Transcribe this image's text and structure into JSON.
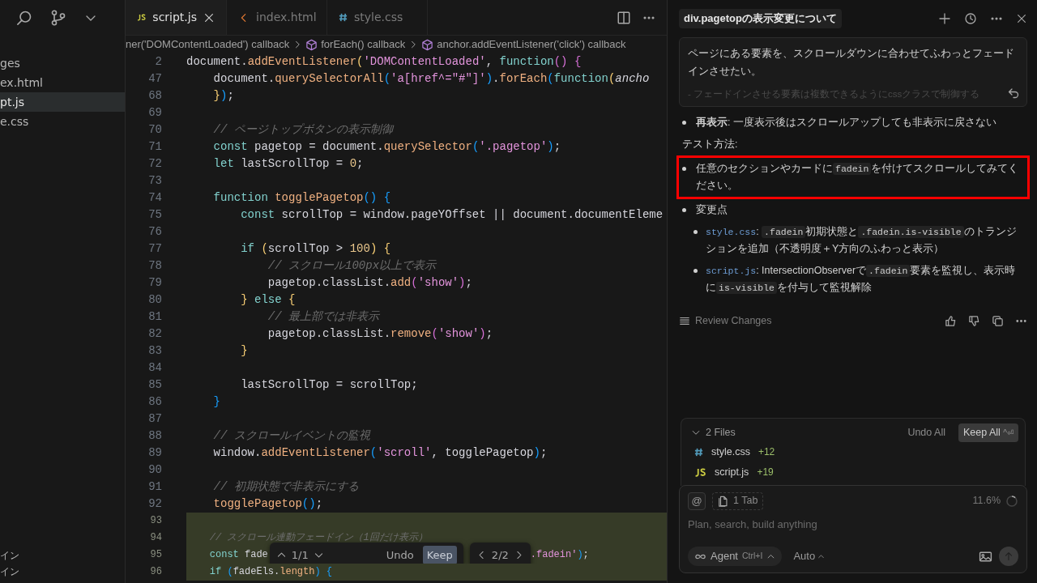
{
  "sidebar": {
    "items": [
      {
        "label": "ges",
        "selected": false
      },
      {
        "label": "ex.html",
        "selected": false
      },
      {
        "label": "pt.js",
        "selected": true
      },
      {
        "label": "e.css",
        "selected": false
      }
    ],
    "bottom_items": [
      "イン",
      "イン"
    ]
  },
  "editor": {
    "tabs": [
      {
        "label": "script.js",
        "kind": "js",
        "selected": true
      },
      {
        "label": "index.html",
        "kind": "html",
        "selected": false
      },
      {
        "label": "style.css",
        "kind": "css",
        "selected": false
      }
    ],
    "breadcrumb": [
      "ner('DOMContentLoaded') callback",
      "forEach() callback",
      "anchor.addEventListener('click') callback"
    ],
    "lines": [
      {
        "n": "2",
        "added": false,
        "tokens": [
          {
            "kind": "id",
            "s": "document."
          },
          {
            "kind": "fn",
            "s": "addEventListener"
          },
          {
            "kind": "b1",
            "s": "("
          },
          {
            "kind": "str",
            "s": "'DOMContentLoaded'"
          },
          {
            "kind": "id",
            "s": ", "
          },
          {
            "kind": "kw",
            "s": "function"
          },
          {
            "kind": "b2",
            "s": "() "
          },
          {
            "kind": "b2",
            "s": "{"
          }
        ]
      },
      {
        "n": "47",
        "added": false,
        "tokens": [
          {
            "kind": "id",
            "s": "    document."
          },
          {
            "kind": "fn",
            "s": "querySelectorAll"
          },
          {
            "kind": "b3",
            "s": "("
          },
          {
            "kind": "str",
            "s": "'a[href^=\"#\"]'"
          },
          {
            "kind": "b3",
            "s": ")"
          },
          {
            "kind": "id",
            "s": "."
          },
          {
            "kind": "fn",
            "s": "forEach"
          },
          {
            "kind": "b3",
            "s": "("
          },
          {
            "kind": "kw",
            "s": "function"
          },
          {
            "kind": "b1",
            "s": "("
          },
          {
            "kind": "param",
            "s": "ancho"
          }
        ]
      },
      {
        "n": "68",
        "added": false,
        "tokens": [
          {
            "kind": "b1",
            "s": "    }"
          },
          {
            "kind": "b3",
            "s": ")"
          },
          {
            "kind": "id",
            "s": ";"
          }
        ]
      },
      {
        "n": "69",
        "added": false
      },
      {
        "n": "70",
        "added": false,
        "tokens": [
          {
            "kind": "cm",
            "s": "    // ページトップボタンの表示制御"
          }
        ]
      },
      {
        "n": "71",
        "added": false,
        "tokens": [
          {
            "kind": "kw",
            "s": "    const"
          },
          {
            "kind": "id",
            "s": " pagetop = document."
          },
          {
            "kind": "fn",
            "s": "querySelector"
          },
          {
            "kind": "b3",
            "s": "("
          },
          {
            "kind": "str",
            "s": "'.pagetop'"
          },
          {
            "kind": "b3",
            "s": ")"
          },
          {
            "kind": "id",
            "s": ";"
          }
        ]
      },
      {
        "n": "72",
        "added": false,
        "tokens": [
          {
            "kind": "kw",
            "s": "    let"
          },
          {
            "kind": "id",
            "s": " lastScrollTop = "
          },
          {
            "kind": "num",
            "s": "0"
          },
          {
            "kind": "id",
            "s": ";"
          }
        ]
      },
      {
        "n": "73",
        "added": false
      },
      {
        "n": "74",
        "added": false,
        "tokens": [
          {
            "kind": "kw",
            "s": "    function "
          },
          {
            "kind": "fn",
            "s": "togglePagetop"
          },
          {
            "kind": "b3",
            "s": "() "
          },
          {
            "kind": "b3",
            "s": "{"
          }
        ]
      },
      {
        "n": "75",
        "added": false,
        "tokens": [
          {
            "kind": "kw",
            "s": "        const"
          },
          {
            "kind": "id",
            "s": " scrollTop = window.pageYOffset || document.documentEleme"
          }
        ]
      },
      {
        "n": "76",
        "added": false
      },
      {
        "n": "77",
        "added": false,
        "tokens": [
          {
            "kind": "kw",
            "s": "        if "
          },
          {
            "kind": "b1",
            "s": "("
          },
          {
            "kind": "id",
            "s": "scrollTop > "
          },
          {
            "kind": "num",
            "s": "100"
          },
          {
            "kind": "b1",
            "s": ") "
          },
          {
            "kind": "b1",
            "s": "{"
          }
        ]
      },
      {
        "n": "78",
        "added": false,
        "tokens": [
          {
            "kind": "cm",
            "s": "            // スクロール100px以上で表示"
          }
        ]
      },
      {
        "n": "79",
        "added": false,
        "tokens": [
          {
            "kind": "id",
            "s": "            pagetop.classList."
          },
          {
            "kind": "fn",
            "s": "add"
          },
          {
            "kind": "b2",
            "s": "("
          },
          {
            "kind": "str",
            "s": "'show'"
          },
          {
            "kind": "b2",
            "s": ")"
          },
          {
            "kind": "id",
            "s": ";"
          }
        ]
      },
      {
        "n": "80",
        "added": false,
        "tokens": [
          {
            "kind": "b1",
            "s": "        }"
          },
          {
            "kind": "kw",
            "s": " else "
          },
          {
            "kind": "b1",
            "s": "{"
          }
        ]
      },
      {
        "n": "81",
        "added": false,
        "tokens": [
          {
            "kind": "cm",
            "s": "            // 最上部では非表示"
          }
        ]
      },
      {
        "n": "82",
        "added": false,
        "tokens": [
          {
            "kind": "id",
            "s": "            pagetop.classList."
          },
          {
            "kind": "fn",
            "s": "remove"
          },
          {
            "kind": "b2",
            "s": "("
          },
          {
            "kind": "str",
            "s": "'show'"
          },
          {
            "kind": "b2",
            "s": ")"
          },
          {
            "kind": "id",
            "s": ";"
          }
        ]
      },
      {
        "n": "83",
        "added": false,
        "tokens": [
          {
            "kind": "b1",
            "s": "        }"
          }
        ]
      },
      {
        "n": "84",
        "added": false
      },
      {
        "n": "85",
        "added": false,
        "tokens": [
          {
            "kind": "id",
            "s": "        lastScrollTop = scrollTop;"
          }
        ]
      },
      {
        "n": "86",
        "added": false,
        "tokens": [
          {
            "kind": "b3",
            "s": "    }"
          }
        ]
      },
      {
        "n": "87",
        "added": false
      },
      {
        "n": "88",
        "added": false,
        "tokens": [
          {
            "kind": "cm",
            "s": "    // スクロールイベントの監視"
          }
        ]
      },
      {
        "n": "89",
        "added": false,
        "tokens": [
          {
            "kind": "id",
            "s": "    window."
          },
          {
            "kind": "fn",
            "s": "addEventListener"
          },
          {
            "kind": "b3",
            "s": "("
          },
          {
            "kind": "str",
            "s": "'scroll'"
          },
          {
            "kind": "id",
            "s": ", togglePagetop"
          },
          {
            "kind": "b3",
            "s": ")"
          },
          {
            "kind": "id",
            "s": ";"
          }
        ]
      },
      {
        "n": "90",
        "added": false
      },
      {
        "n": "91",
        "added": false,
        "tokens": [
          {
            "kind": "cm",
            "s": "    // 初期状態で非表示にする"
          }
        ]
      },
      {
        "n": "92",
        "added": false,
        "tokens": [
          {
            "kind": "fn",
            "s": "    togglePagetop"
          },
          {
            "kind": "b3",
            "s": "()"
          },
          {
            "kind": "id",
            "s": ";"
          }
        ]
      },
      {
        "n": "93",
        "added": true
      },
      {
        "n": "94",
        "added": true,
        "tokens": [
          {
            "kind": "cm",
            "s": "    // スクロール連動フェードイン（1回だけ表示）"
          }
        ]
      },
      {
        "n": "95",
        "added": true,
        "tokens": [
          {
            "kind": "kw",
            "s": "    const"
          },
          {
            "kind": "id",
            "s": " fade"
          }
        ],
        "diff_toolbar": {
          "hunk_counter": "1/1",
          "undo": "Undo",
          "keep": "Keep",
          "file_counter": "2/2"
        },
        "tokens_after": [
          {
            "kind": "str",
            "s": ".fadein'"
          },
          {
            "kind": "b3",
            "s": ")"
          },
          {
            "kind": "id",
            "s": ";"
          }
        ]
      },
      {
        "n": "96",
        "added": true,
        "tokens": [
          {
            "kind": "kw",
            "s": "    if "
          },
          {
            "kind": "b3",
            "s": "("
          },
          {
            "kind": "id",
            "s": "fadeEls."
          },
          {
            "kind": "fn",
            "s": "length"
          },
          {
            "kind": "b3",
            "s": ") "
          },
          {
            "kind": "b3",
            "s": "{"
          }
        ]
      }
    ]
  },
  "chat": {
    "title": "div.pagetopの表示変更について",
    "user_message": {
      "text": "ページにある要素を、スクロールダウンに合わせてふわっとフェードインさせたい。",
      "faded_line": "- フェードインさせる要素は複数できるようにcssクラスで制御する"
    },
    "blocks": [
      {
        "kind": "bullet",
        "highlighted": false,
        "segments": [
          {
            "kind": "text",
            "s": "**再表示**: 一度表示後はスクロールアップしても非表示に戻さない"
          }
        ]
      },
      {
        "kind": "heading",
        "highlighted": false,
        "segments": [
          {
            "kind": "text",
            "s": "テスト方法:"
          }
        ]
      },
      {
        "kind": "bullet",
        "highlighted": true,
        "segments": [
          {
            "kind": "text",
            "s": "任意のセクションやカードに"
          },
          {
            "kind": "code",
            "s": "fadein"
          },
          {
            "kind": "text",
            "s": "を付けてスクロールしてみてください。"
          }
        ]
      },
      {
        "kind": "bullet",
        "highlighted": false,
        "segments": [
          {
            "kind": "text",
            "s": "変更点"
          }
        ],
        "children": [
          {
            "kind": "bullet",
            "highlighted": false,
            "segments": [
              {
                "kind": "file",
                "s": "style.css"
              },
              {
                "kind": "text",
                "s": ": "
              },
              {
                "kind": "code",
                "s": ".fadein"
              },
              {
                "kind": "text",
                "s": "初期状態と"
              },
              {
                "kind": "code",
                "s": ".fadein.is-visible"
              },
              {
                "kind": "text",
                "s": "のトランジションを追加（不透明度＋Y方向のふわっと表示）"
              }
            ]
          },
          {
            "kind": "bullet",
            "highlighted": false,
            "segments": [
              {
                "kind": "file",
                "s": "script.js"
              },
              {
                "kind": "text",
                "s": ": IntersectionObserverで"
              },
              {
                "kind": "code",
                "s": ".fadein"
              },
              {
                "kind": "text",
                "s": "要素を監視し、表示時に"
              },
              {
                "kind": "code",
                "s": "is-visible"
              },
              {
                "kind": "text",
                "s": "を付与して監視解除"
              }
            ]
          }
        ]
      }
    ],
    "review_label": "Review Changes",
    "files": {
      "expanded": true,
      "count_label": "2 Files",
      "undo_all": "Undo All",
      "keep_all": "Keep All",
      "shortcut": "^⏎",
      "items": [
        {
          "kind": "css",
          "name": "style.css",
          "added": "+12"
        },
        {
          "kind": "js",
          "name": "script.js",
          "added": "+19"
        }
      ]
    },
    "composer": {
      "mention": "@",
      "tab_chip": "1 Tab",
      "context": {
        "reading": "11.6%",
        "level": 0.116
      },
      "placeholder": "Plan, search, build anything",
      "mode": "Agent",
      "mode_shortcut": "Ctrl+I",
      "model": "Auto",
      "send_disabled": true
    }
  }
}
